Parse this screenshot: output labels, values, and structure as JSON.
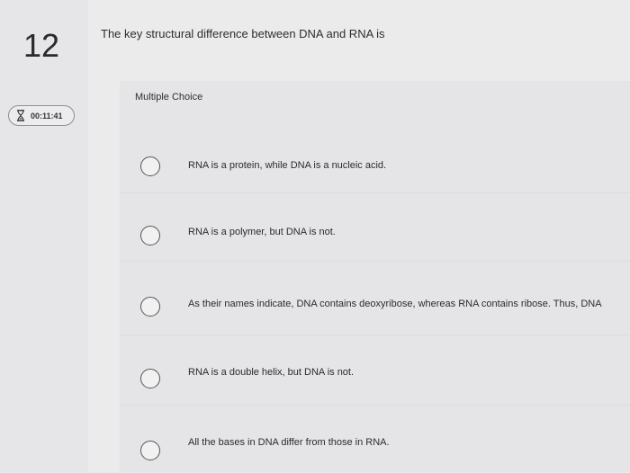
{
  "question": {
    "number": "12",
    "prompt": "The key structural difference between DNA and RNA is",
    "type_label": "Multiple Choice"
  },
  "timer": {
    "icon": "hourglass-icon",
    "time": "00:11:41"
  },
  "options": [
    {
      "label": "RNA is a protein, while DNA is a nucleic acid."
    },
    {
      "label": "RNA is a polymer, but DNA is not."
    },
    {
      "label": "As their names indicate, DNA contains deoxyribose, whereas RNA contains ribose. Thus, DNA"
    },
    {
      "label": "RNA is a double helix, but DNA is not."
    },
    {
      "label": "All the bases in DNA differ from those in RNA."
    }
  ]
}
